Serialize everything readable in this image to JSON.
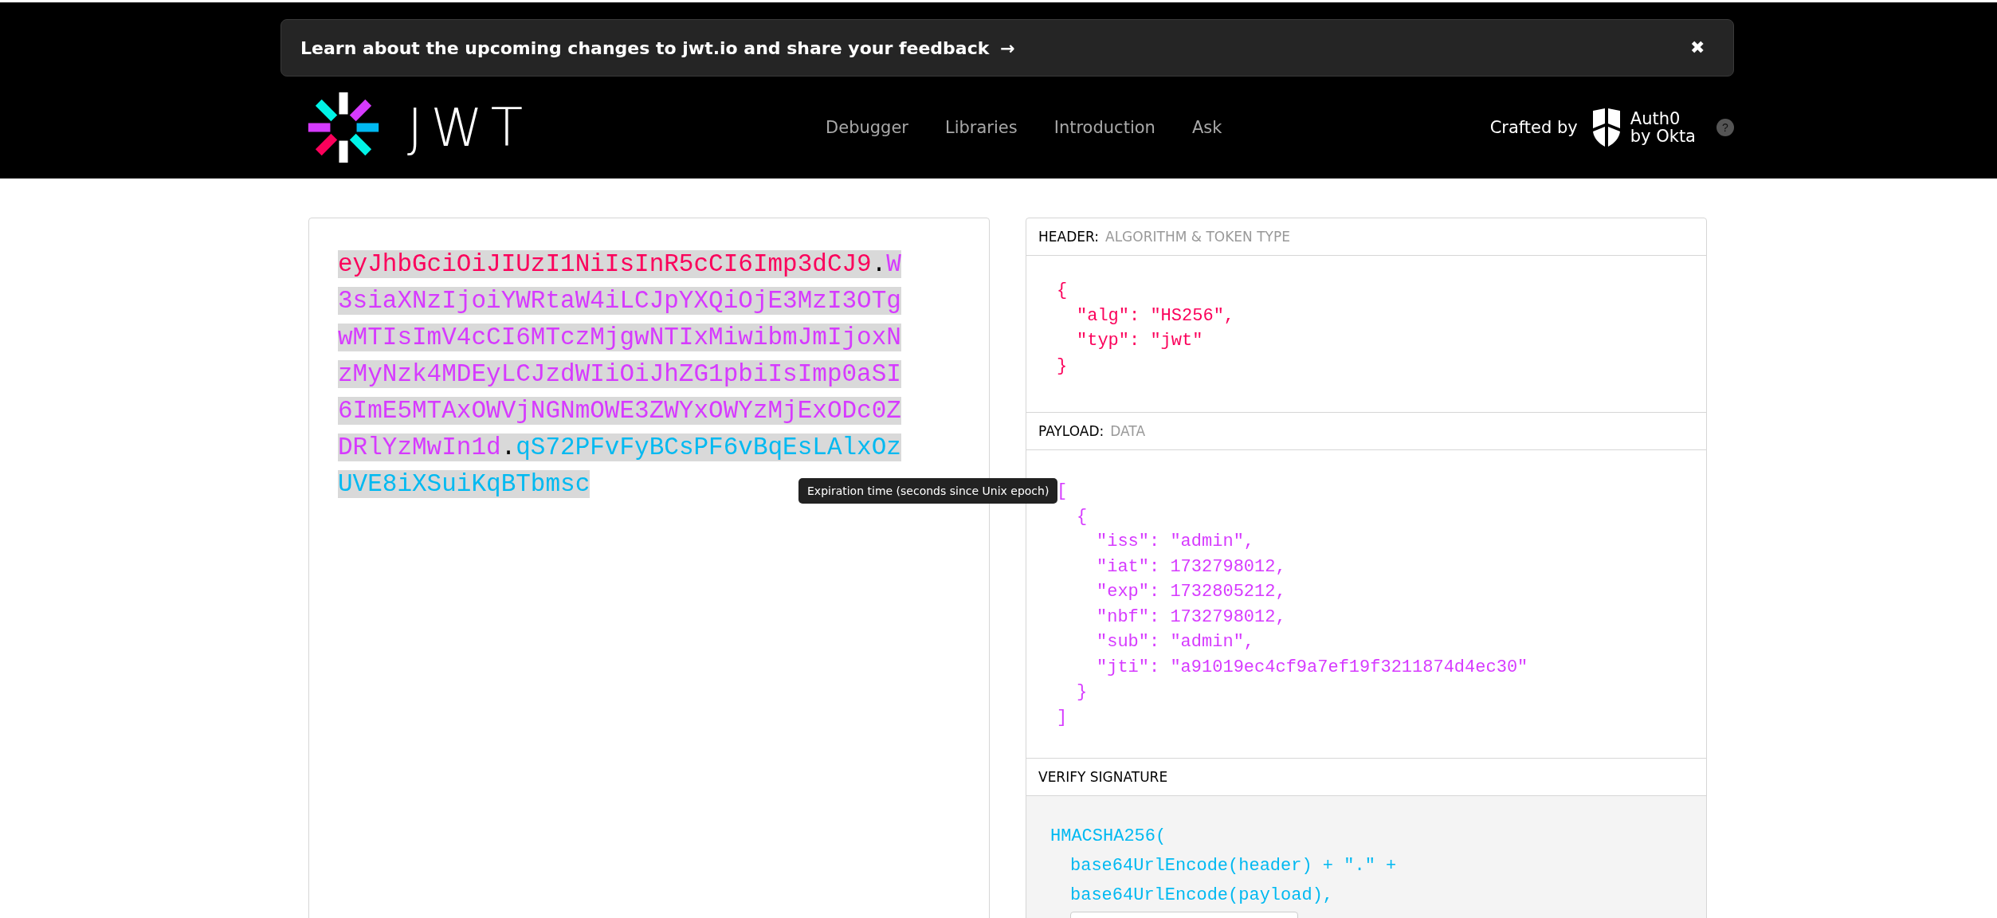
{
  "banner": {
    "text": "Learn about the upcoming changes to jwt.io and share your feedback",
    "arrow": "→",
    "close": "✖"
  },
  "nav": {
    "logo_text": "JWT",
    "links": [
      {
        "label": "Debugger",
        "selected": false
      },
      {
        "label": "Libraries",
        "selected": false
      },
      {
        "label": "Introduction",
        "selected": false
      },
      {
        "label": "Ask",
        "selected": false
      }
    ],
    "crafted_by": "Crafted by",
    "brand_line_1": "Auth0",
    "brand_line_2": "by Okta",
    "help": "?"
  },
  "encoded": {
    "token": [
      {
        "kind": "header",
        "text": "eyJhbGciOiJIUzI1NiIsInR5cCI6Imp3dCJ9"
      },
      {
        "kind": "dot",
        "text": "."
      },
      {
        "kind": "payload",
        "text": "W3siaXNzIjoiYWRtaW4iLCJpYXQiOjE3MzI3OTgwMTIsImV4cCI6MTczMjgwNTIxMiwibmJmIjoxNzMyNzk4MDEyLCJzdWIiOiJhZG1pbiIsImp0aSI6ImE5MTAxOWVjNGNmOWE3ZWYxOWYzMjExODc0ZDRlYzMwIn1d"
      },
      {
        "kind": "dot",
        "text": "."
      },
      {
        "kind": "signature",
        "text": "qS72PFvFyBCsPF6vBqEsLAlxOzUVE8iXSuiKqBTbmsc"
      }
    ]
  },
  "tooltip": "Expiration time (seconds since Unix epoch)",
  "decoded": {
    "header": {
      "label": "HEADER:",
      "sublabel": "ALGORITHM & TOKEN TYPE",
      "open": "{",
      "entries": [
        "\"alg\": \"HS256\",",
        "\"typ\": \"jwt\""
      ],
      "close": "}"
    },
    "payload": {
      "label": "PAYLOAD:",
      "sublabel": "DATA",
      "open": "[",
      "items": [
        {
          "open": "{",
          "entries": [
            "\"iss\": \"admin\",",
            "\"iat\": 1732798012,",
            "\"exp\": 1732805212,",
            "\"nbf\": 1732798012,",
            "\"sub\": \"admin\",",
            "\"jti\": \"a91019ec4cf9a7ef19f3211874d4ec30\""
          ],
          "close": "}"
        }
      ],
      "close": "]"
    },
    "verify": {
      "label": "VERIFY SIGNATURE",
      "lines": [
        "HMACSHA256(",
        "base64UrlEncode(header) + \".\" +",
        "base64UrlEncode(payload),"
      ]
    }
  }
}
